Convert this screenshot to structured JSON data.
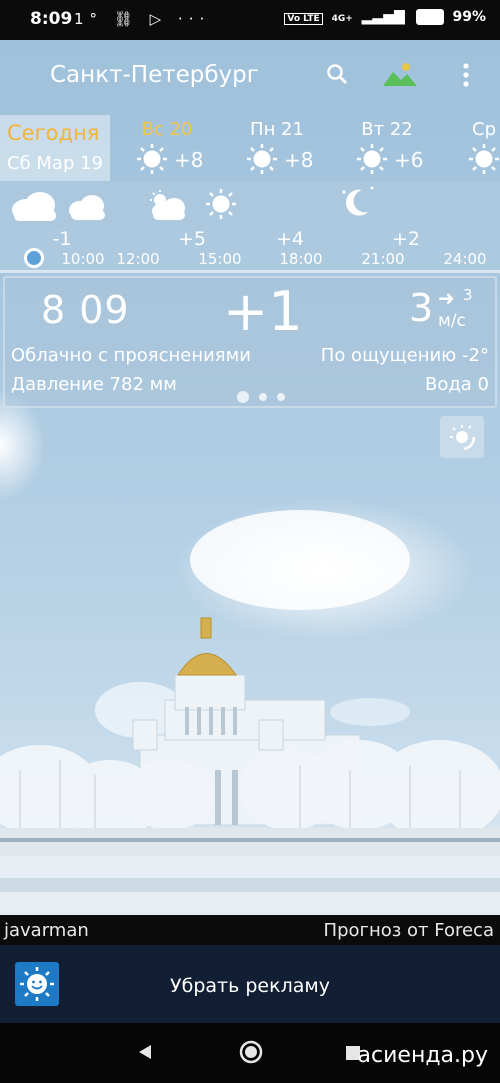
{
  "status_bar": {
    "time": "8:09",
    "extra_icons": "1° ⛓ ▷ ···",
    "network": "4G+",
    "battery": "99%"
  },
  "app_bar": {
    "city": "Санкт-Петербург"
  },
  "days": {
    "today": {
      "label": "Сегодня",
      "date": "Сб Мар 19"
    },
    "list": [
      {
        "name": "Вс 20",
        "temp": "+8"
      },
      {
        "name": "Пн 21",
        "temp": "+8"
      },
      {
        "name": "Вт 22",
        "temp": "+6"
      },
      {
        "name": "Ср",
        "temp": ""
      }
    ]
  },
  "hourly": [
    {
      "time": "10:00",
      "temp": "-1"
    },
    {
      "time": "12:00",
      "temp": ""
    },
    {
      "time": "15:00",
      "temp": "+5"
    },
    {
      "time": "18:00",
      "temp": "+4"
    },
    {
      "time": "21:00",
      "temp": "+2"
    },
    {
      "time": "24:00",
      "temp": ""
    }
  ],
  "current": {
    "clock": "8 09",
    "temperature": "+1",
    "wind_speed": "3",
    "wind_gust": "3",
    "wind_unit": "м/с",
    "condition": "Облачно с прояснениями",
    "feels_like": "По ощущению -2°",
    "pressure": "Давление 782 мм",
    "water": "Вода 0"
  },
  "footer": {
    "user": "javarman",
    "forecast_source": "Прогноз от Foreca"
  },
  "ad": {
    "label": "Убрать рекламу"
  },
  "watermark": "асиенда.ру",
  "colors": {
    "today_label": "#f3b43b",
    "day_name_highlight": "#f3c445",
    "ad_bar": "#121e33",
    "ad_icon": "#1f7ac6"
  }
}
